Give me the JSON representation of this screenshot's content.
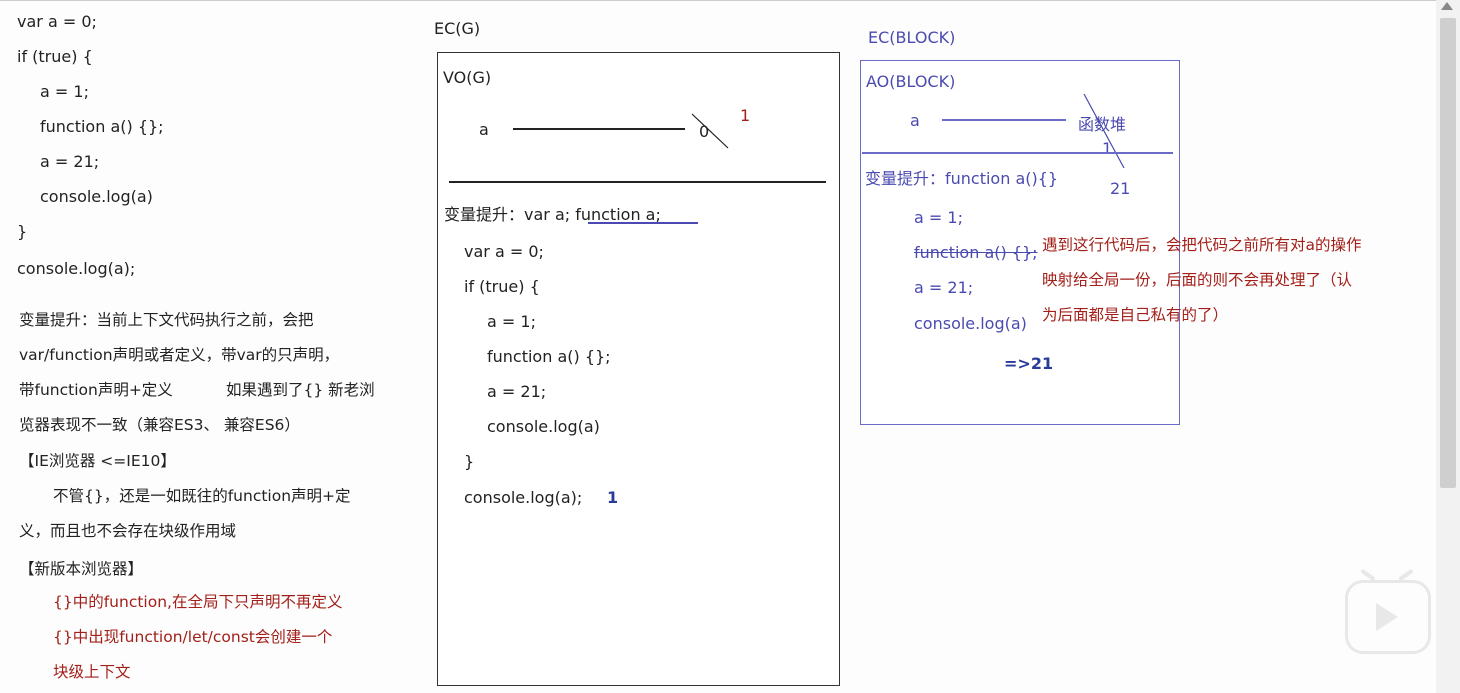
{
  "left_code": [
    "var a = 0;",
    "if (true) {",
    "a = 1;",
    "function a() {};",
    "a = 21;",
    "console.log(a)",
    "}",
    "console.log(a);"
  ],
  "left_notes": {
    "p1": "变量提升：当前上下文代码执行之前，会把",
    "p2": "var/function声明或者定义，带var的只声明，",
    "p3": "带function声明+定义",
    "p3b": "如果遇到了{} 新老浏",
    "p4": "览器表现不一致（兼容ES3、 兼容ES6）",
    "ie_title": "【IE浏览器 <=IE10】",
    "ie1": "不管{}，还是一如既往的function声明+定",
    "ie2": "义，而且也不会存在块级作用域",
    "new_title": "【新版本浏览器】",
    "new1": "{}中的function,在全局下只声明不再定义",
    "new2": "{}中出现function/let/const会创建一个",
    "new3": "块级上下文"
  },
  "ecg": {
    "title": "EC(G)",
    "vo": "VO(G)",
    "var_a": "a",
    "old_val": "0",
    "new_val": "1",
    "hoist": "变量提升：var a;  function a;",
    "code": [
      "var a = 0;",
      "if (true) {",
      "a = 1;",
      "function a() {};",
      "a = 21;",
      "console.log(a)",
      "}",
      "console.log(a);"
    ],
    "output": "1"
  },
  "ecb": {
    "title": "EC(BLOCK)",
    "ao": "AO(BLOCK)",
    "var_a": "a",
    "heap": "函数堆",
    "val1": "1",
    "val21": "21",
    "hoist": "变量提升：function a(){}",
    "code": [
      "a = 1;",
      "function a() {};",
      "a = 21;",
      "console.log(a)"
    ],
    "result": "=>21",
    "note1": "遇到这行代码后，会把代码之前所有对a的操作",
    "note2": "映射给全局一份，后面的则不会再处理了（认",
    "note3": "为后面都是自己私有的了）"
  }
}
